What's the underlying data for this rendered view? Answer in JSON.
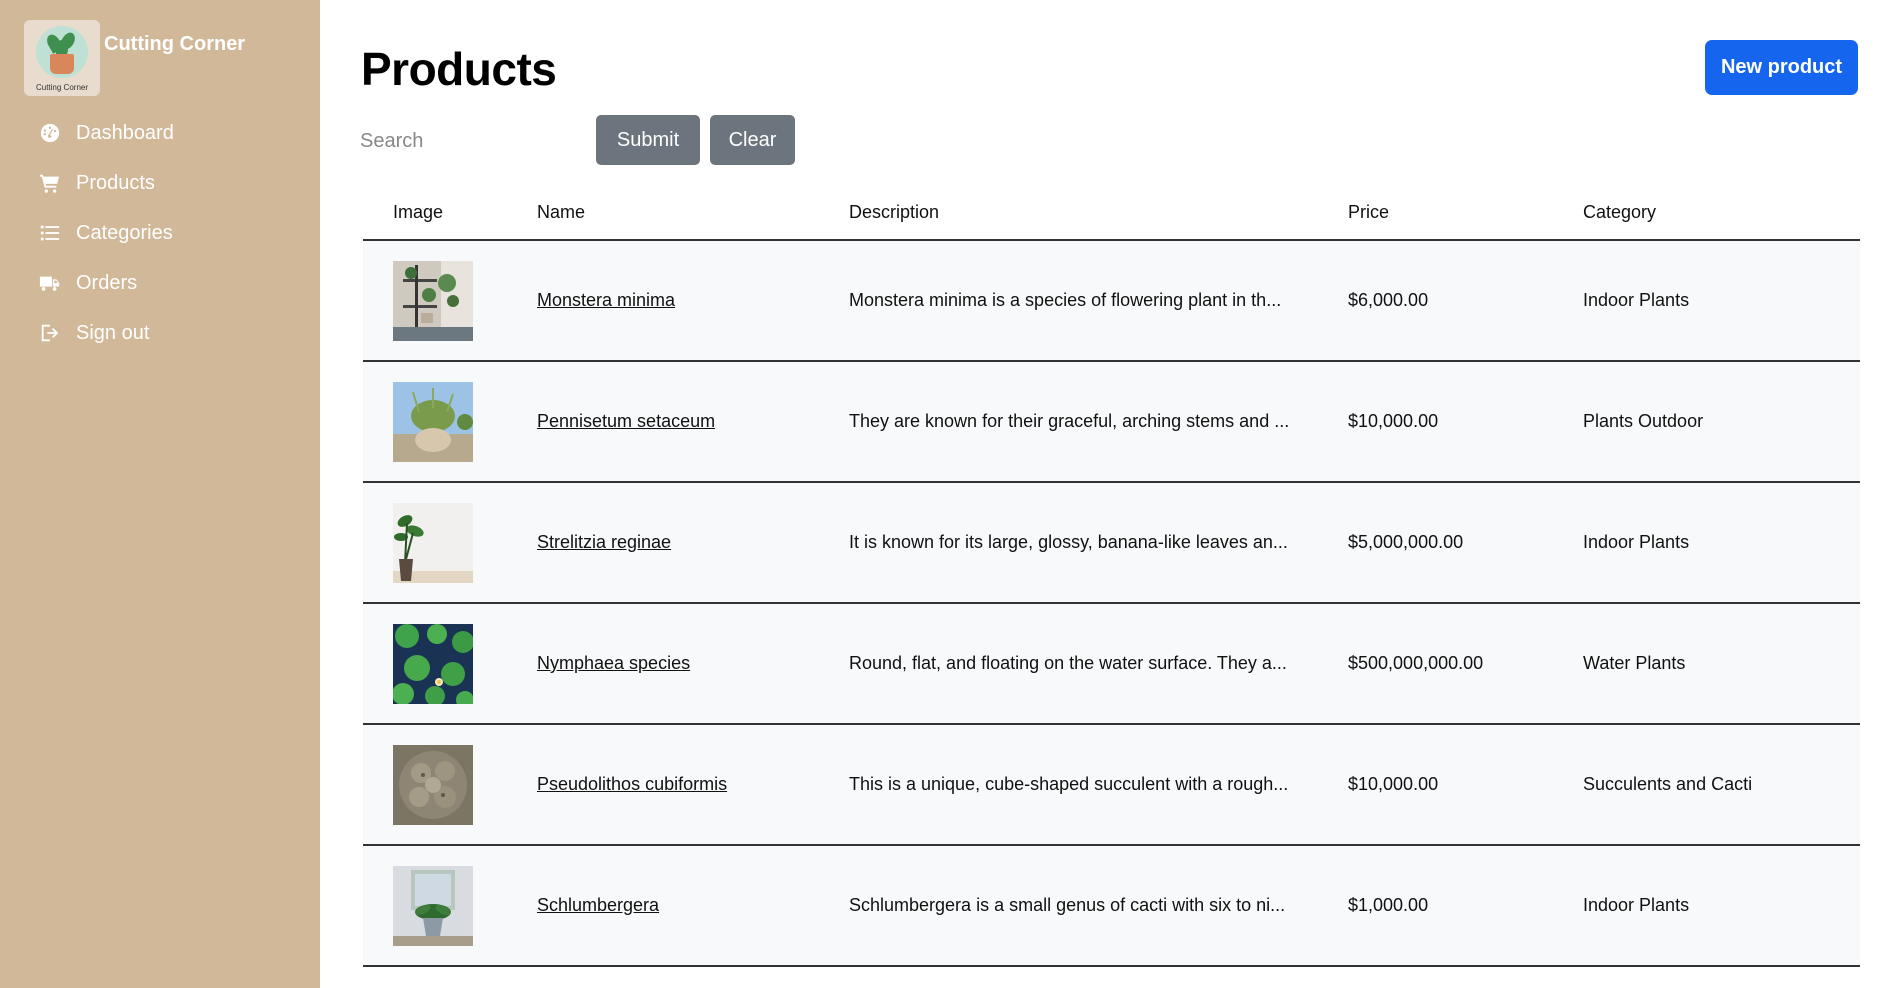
{
  "sidebar": {
    "brand_name": "Cutting Corner",
    "logo_text": "Cutting Corner",
    "items": [
      {
        "label": "Dashboard",
        "icon": "gauge-icon"
      },
      {
        "label": "Products",
        "icon": "cart-icon"
      },
      {
        "label": "Categories",
        "icon": "list-icon"
      },
      {
        "label": "Orders",
        "icon": "truck-icon"
      },
      {
        "label": "Sign out",
        "icon": "sign-out-icon"
      }
    ]
  },
  "header": {
    "title": "Products",
    "new_button": "New product"
  },
  "search": {
    "placeholder": "Search",
    "value": "",
    "submit_label": "Submit",
    "clear_label": "Clear"
  },
  "table": {
    "columns": [
      "Image",
      "Name",
      "Description",
      "Price",
      "Category"
    ],
    "rows": [
      {
        "image": "monstera-photo",
        "name": "Monstera minima",
        "description": "Monstera minima is a species of flowering plant in th...",
        "price": "$6,000.00",
        "category": "Indoor Plants"
      },
      {
        "image": "pennisetum-photo",
        "name": "Pennisetum setaceum",
        "description": "They are known for their graceful, arching stems and ...",
        "price": "$10,000.00",
        "category": "Plants Outdoor"
      },
      {
        "image": "strelitzia-photo",
        "name": "Strelitzia reginae",
        "description": "It is known for its large, glossy, banana-like leaves an...",
        "price": "$5,000,000.00",
        "category": "Indoor Plants"
      },
      {
        "image": "nymphaea-photo",
        "name": "Nymphaea species",
        "description": "Round, flat, and floating on the water surface. They a...",
        "price": "$500,000,000.00",
        "category": "Water Plants"
      },
      {
        "image": "pseudolithos-photo",
        "name": "Pseudolithos cubiformis",
        "description": "This is a unique, cube-shaped succulent with a rough...",
        "price": "$10,000.00",
        "category": "Succulents and Cacti"
      },
      {
        "image": "schlumbergera-photo",
        "name": "Schlumbergera",
        "description": "Schlumbergera is a small genus of cacti with six to ni...",
        "price": "$1,000.00",
        "category": "Indoor Plants"
      }
    ]
  },
  "colors": {
    "sidebar_bg": "#d1b899",
    "primary": "#1565ef",
    "secondary": "#6c757d",
    "row_bg": "#f8f9fa"
  }
}
